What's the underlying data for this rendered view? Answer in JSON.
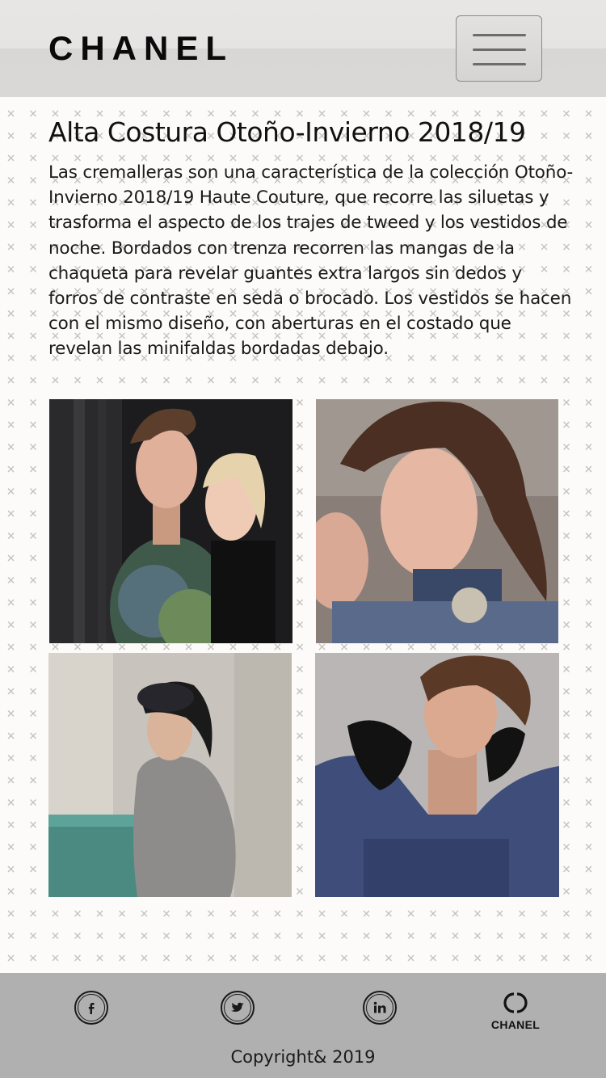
{
  "header": {
    "logo": "CHANEL",
    "menu_icon": "hamburger-menu-icon"
  },
  "article": {
    "title": "Alta Costura Otoño-Invierno 2018/19",
    "body": "Las cremalleras son una característica de la colección Otoño-Invierno 2018/19 Haute Couture, que recorre las siluetas y trasforma el aspecto de los trajes de tweed y los vestidos de noche. Bordados con trenza recorren las mangas de la chaqueta para revelar guantes extra largos sin dedos y forros de contraste en seda o brocado. Los vestidos se hacen con el mismo diseño, con aberturas en el costado que revelan las minifaldas bordadas debajo."
  },
  "gallery": {
    "photos": [
      "model-photo-1",
      "model-photo-2",
      "model-photo-3",
      "model-photo-4"
    ]
  },
  "footer": {
    "social_icons": [
      "facebook-icon",
      "twitter-icon",
      "linkedin-icon"
    ],
    "brand_word": "CHANEL",
    "copyright": "Copyright& 2019"
  },
  "colors": {
    "header_bg": "#e6e4e3",
    "footer_bg": "#b0b0b0",
    "page_bg": "#fcfbf9",
    "text": "#111111"
  }
}
